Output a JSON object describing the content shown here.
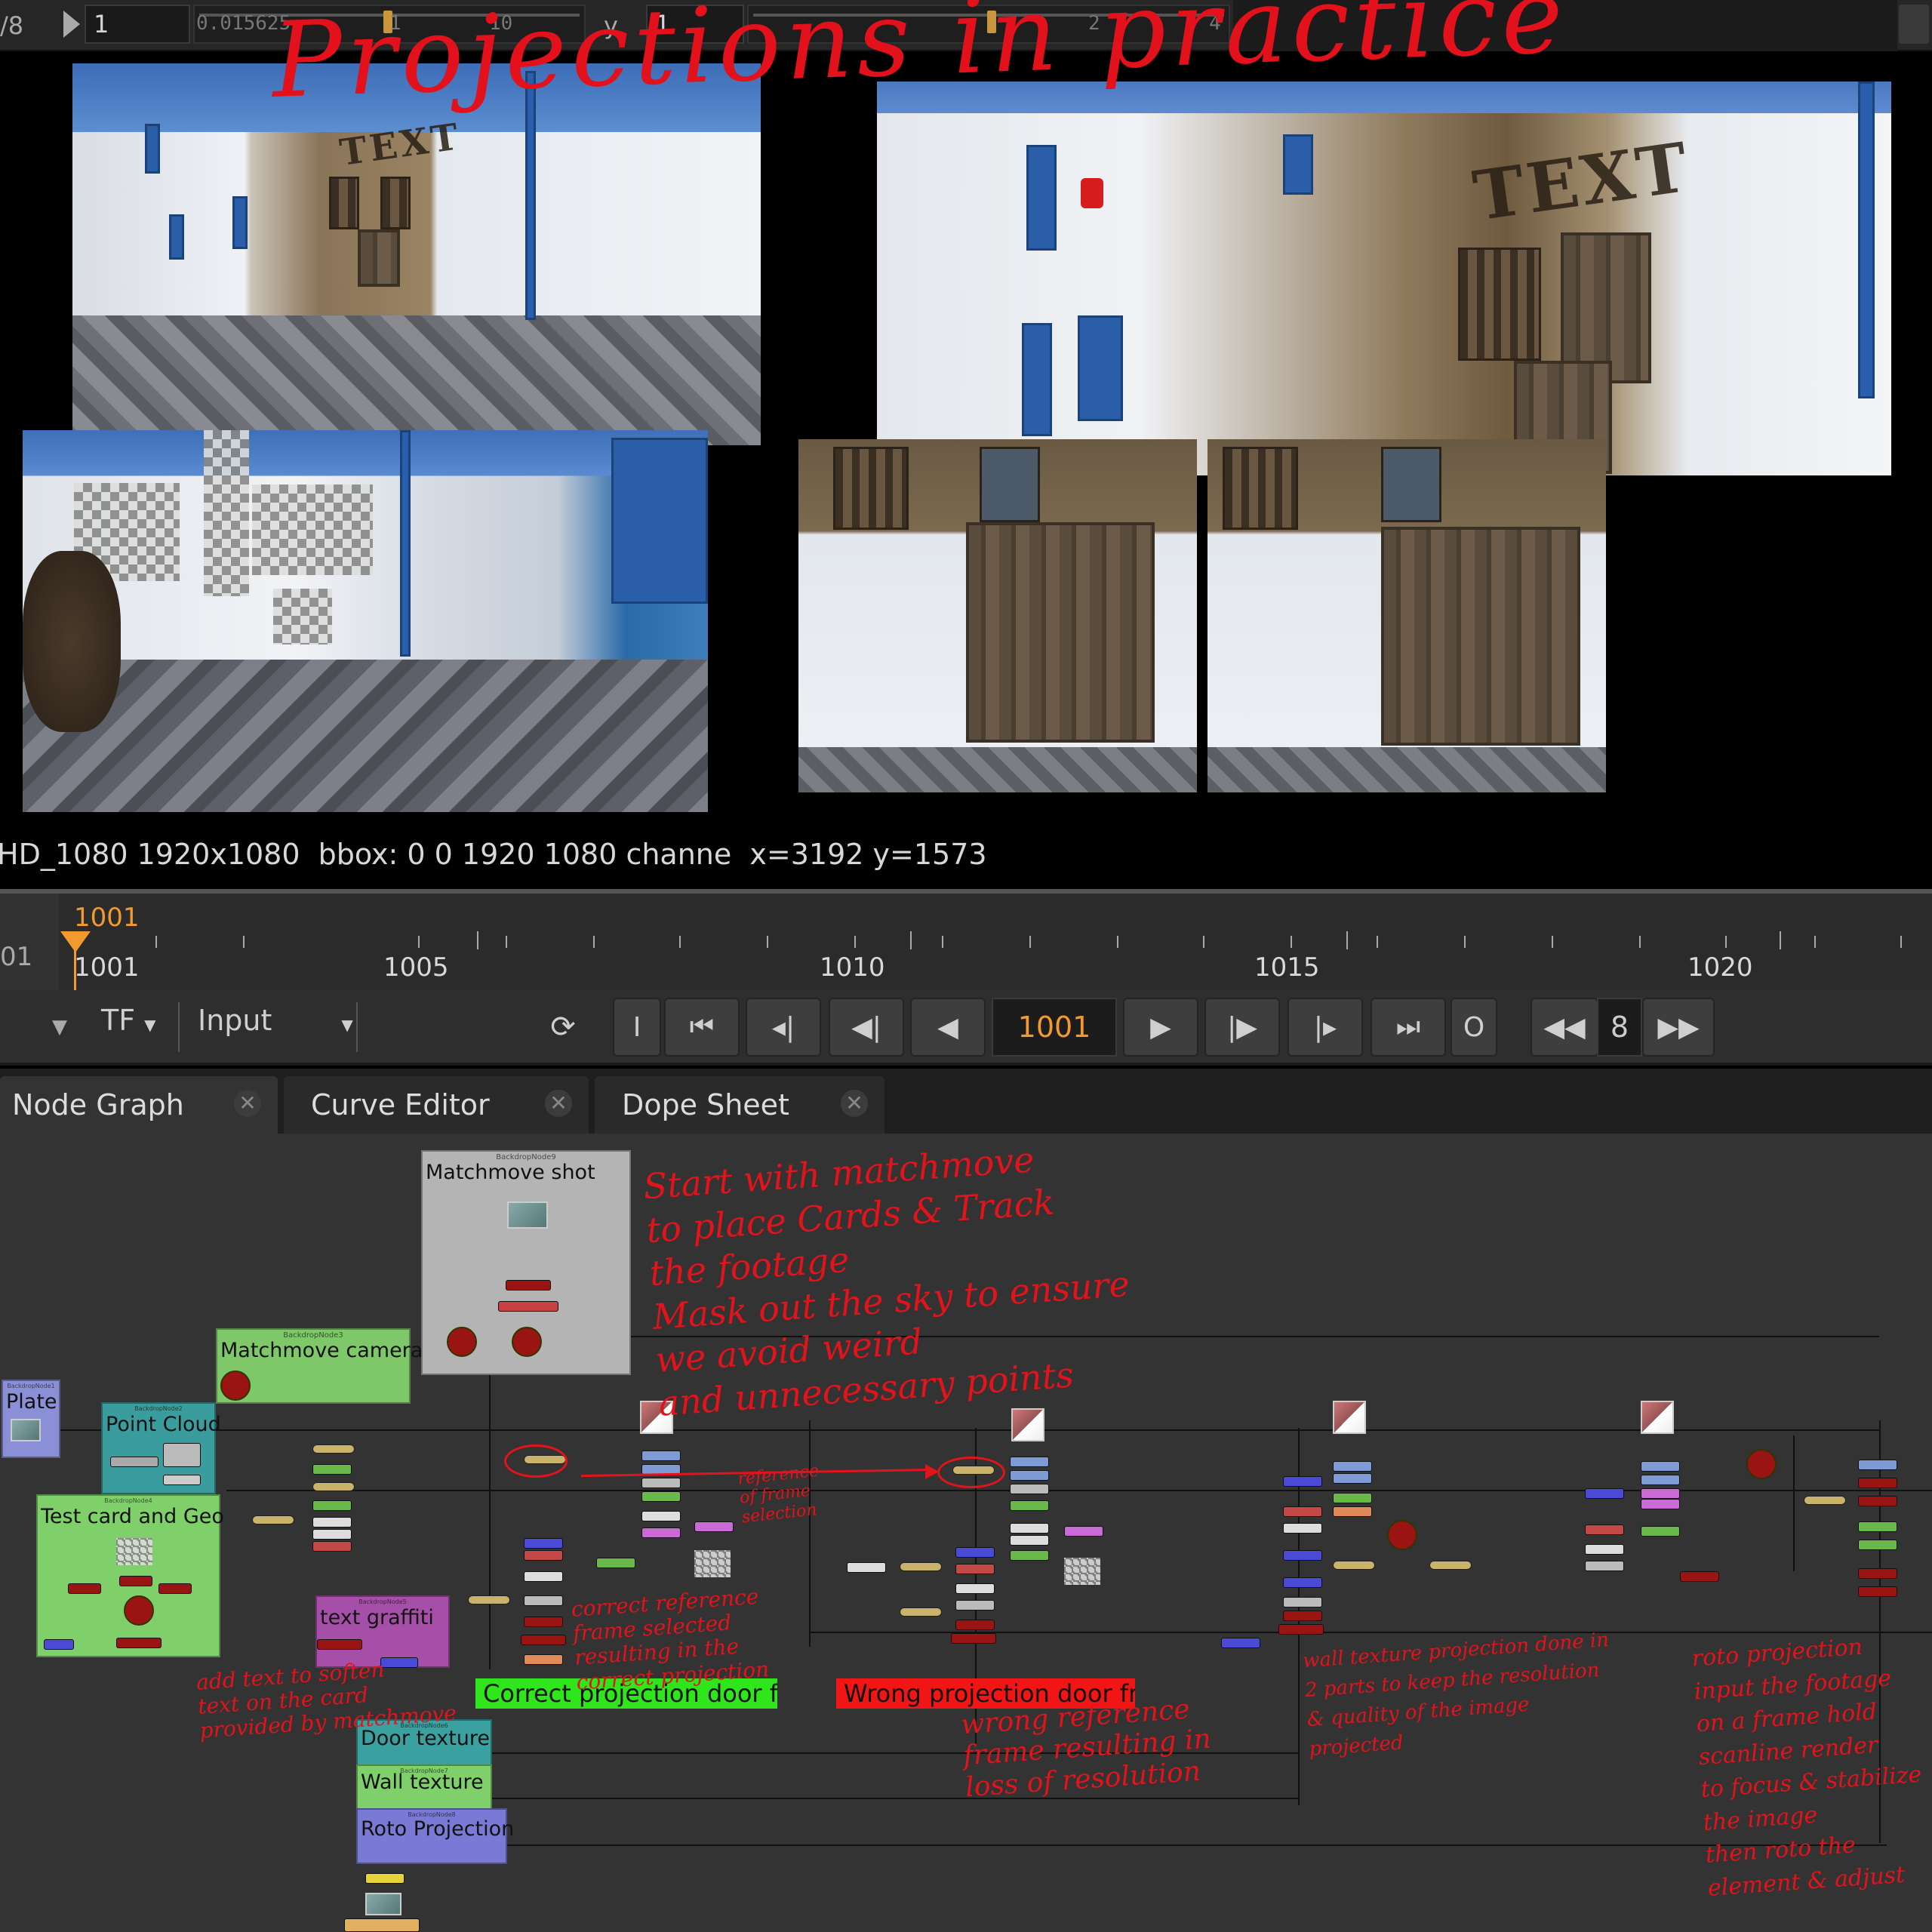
{
  "top_controls": {
    "frame_ratio": "/8",
    "field_a": "1",
    "slider_a_value": "0.015625",
    "slider_a_ticks": [
      "1",
      "10"
    ],
    "y_label": "y",
    "field_b": "1",
    "slider_b_ticks": [
      "2",
      "4"
    ]
  },
  "viewer": {
    "title_scribble": "Projections in practice",
    "wall_text": "TEXT",
    "info_line": "HD_1080 1920x1080  bbox: 0 0 1920 1080 channe  x=3192 y=1573"
  },
  "timeline": {
    "current_frame_label": "1001",
    "left_number": "01",
    "tick_labels": [
      "1001",
      "1005",
      "1010",
      "1015",
      "1020"
    ]
  },
  "transport": {
    "tf_label": "TF",
    "input_dropdown": "Input",
    "in_button": "I",
    "current_frame": "1001",
    "out_button": "O",
    "step_value": "8",
    "current_frame_color": "#f29a2e"
  },
  "tabs": [
    {
      "label": "Node Graph"
    },
    {
      "label": "Curve Editor"
    },
    {
      "label": "Dope Sheet"
    }
  ],
  "node_graph": {
    "backdrops": {
      "matchmove_shot": {
        "id": "BackdropNode9",
        "label": "Matchmove shot",
        "color": "#b4b4b4"
      },
      "matchmove_camera": {
        "id": "BackdropNode3",
        "label": "Matchmove camera",
        "color": "#7fc86a"
      },
      "plate": {
        "id": "BackdropNode1",
        "label": "Plate",
        "color": "#8b8fd6"
      },
      "point_cloud": {
        "id": "BackdropNode2",
        "label": "Point Cloud",
        "color": "#3a9c9c"
      },
      "test_card": {
        "id": "BackdropNode4",
        "label": "Test card and Geo",
        "color": "#7fd06a"
      },
      "text_graffiti": {
        "id": "BackdropNode5",
        "label": "text graffiti",
        "color": "#a64fa8"
      },
      "door_texture": {
        "id": "BackdropNode6",
        "label": "Door texture",
        "color": "#3aa0a0"
      },
      "wall_texture": {
        "id": "BackdropNode7",
        "label": "Wall texture",
        "color": "#7fd06a"
      },
      "roto_projection": {
        "id": "BackdropNode8",
        "label": "Roto Projection",
        "color": "#7a7ad6"
      }
    },
    "status_labels": {
      "correct": "Correct projection door frame",
      "wrong": "Wrong projection door frame",
      "correct_color": "#2ee61b",
      "wrong_color": "#f21515"
    },
    "annotations": {
      "matchmove_note": "Start with matchmove\nto place Cards & Track\nthe footage\nMask out the sky to ensure\nwe avoid weird\nand unnecessary points",
      "reference_arrow_note": "reference\nof frame\nselection",
      "correct_note": "correct reference\nframe selected\nresulting in the\ncorrect projection",
      "wrong_note": "wrong reference\nframe resulting in\nloss of resolution",
      "texture_note": "wall texture projection done in\n2 parts to keep the resolution\n& quality of the image\nprojected",
      "roto_note": "roto projection\ninput the footage\non a frame hold\nscanline render\nto focus & stabilize\nthe image\nthen roto the\nelement & adjust",
      "graffiti_note": "add text to soften\ntext on the card\nprovided by matchmove"
    }
  }
}
